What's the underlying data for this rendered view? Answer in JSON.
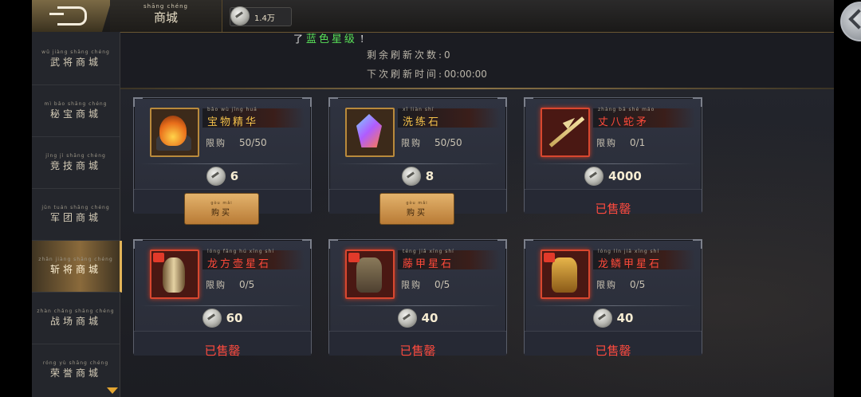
{
  "header": {
    "title_pinyin": "shāng chéng",
    "title": "商城",
    "currency_amount": "1.4万"
  },
  "notice": {
    "prefix": "了",
    "highlight": "蓝色星级",
    "suffix": "!"
  },
  "refresh": {
    "remaining_label": "剩余刷新次数:",
    "remaining_value": "0",
    "next_label": "下次刷新时间:",
    "next_value": "00:00:00"
  },
  "sidebar": {
    "items": [
      {
        "pinyin": "wǔ jiàng shāng chéng",
        "label": "武将商城"
      },
      {
        "pinyin": "mì bǎo shāng chéng",
        "label": "秘宝商城"
      },
      {
        "pinyin": "jìng jì shāng chéng",
        "label": "竞技商城"
      },
      {
        "pinyin": "jūn tuán shāng chéng",
        "label": "军团商城"
      },
      {
        "pinyin": "zhǎn jiàng shāng chéng",
        "label": "斩将商城"
      },
      {
        "pinyin": "zhàn chǎng shāng chéng",
        "label": "战场商城"
      },
      {
        "pinyin": "róng yù shāng chéng",
        "label": "荣誉商城"
      }
    ],
    "active_index": 4
  },
  "items": [
    {
      "name_pinyin": "bǎo wù jīng huá",
      "name": "宝物精华",
      "limit_label": "限购",
      "limit": "50/50",
      "price": "6",
      "action": "购买",
      "action_pinyin": "gòu mǎi"
    },
    {
      "name_pinyin": "xǐ liàn shí",
      "name": "洗练石",
      "limit_label": "限购",
      "limit": "50/50",
      "price": "8",
      "action": "购买",
      "action_pinyin": "gòu mǎi"
    },
    {
      "name_pinyin": "zhàng bā shé máo",
      "name": "丈八蛇矛",
      "limit_label": "限购",
      "limit": "0/1",
      "price": "4000",
      "status": "已售罄"
    },
    {
      "name_pinyin": "lóng fāng hú xīng shí",
      "name": "龙方壶星石",
      "limit_label": "限购",
      "limit": "0/5",
      "price": "60",
      "status": "已售罄"
    },
    {
      "name_pinyin": "téng jiǎ xīng shí",
      "name": "藤甲星石",
      "limit_label": "限购",
      "limit": "0/5",
      "price": "40",
      "status": "已售罄"
    },
    {
      "name_pinyin": "lóng lín jiǎ xīng shí",
      "name": "龙鳞甲星石",
      "limit_label": "限购",
      "limit": "0/5",
      "price": "40",
      "status": "已售罄"
    }
  ],
  "colors": {
    "name_gold": "#f3c04a",
    "name_red": "#ff4a3a",
    "sold_out": "#ff4b3e",
    "accent": "#e2b458"
  },
  "icons": [
    "back-arrow-icon",
    "silver-coin-icon",
    "chevron-left-icon",
    "scroll-down-icon"
  ]
}
